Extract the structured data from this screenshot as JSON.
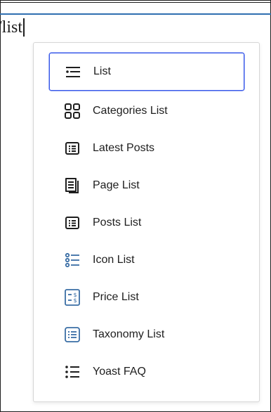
{
  "editor": {
    "text": "/list"
  },
  "menu": {
    "items": [
      {
        "label": "List",
        "icon": "list-icon",
        "selected": true
      },
      {
        "label": "Categories List",
        "icon": "categories-grid-icon"
      },
      {
        "label": "Latest Posts",
        "icon": "latest-posts-icon"
      },
      {
        "label": "Page List",
        "icon": "page-list-icon"
      },
      {
        "label": "Posts List",
        "icon": "posts-list-icon"
      },
      {
        "label": "Icon List",
        "icon": "icon-list-icon",
        "color": "#3a6ea5"
      },
      {
        "label": "Price List",
        "icon": "price-list-icon",
        "color": "#3a6ea5"
      },
      {
        "label": "Taxonomy List",
        "icon": "taxonomy-list-icon",
        "color": "#3a6ea5"
      },
      {
        "label": "Yoast FAQ",
        "icon": "yoast-faq-icon"
      }
    ]
  },
  "colors": {
    "selection": "#3858e9",
    "accent_icon": "#3a6ea5",
    "text": "#1e1e1e"
  }
}
